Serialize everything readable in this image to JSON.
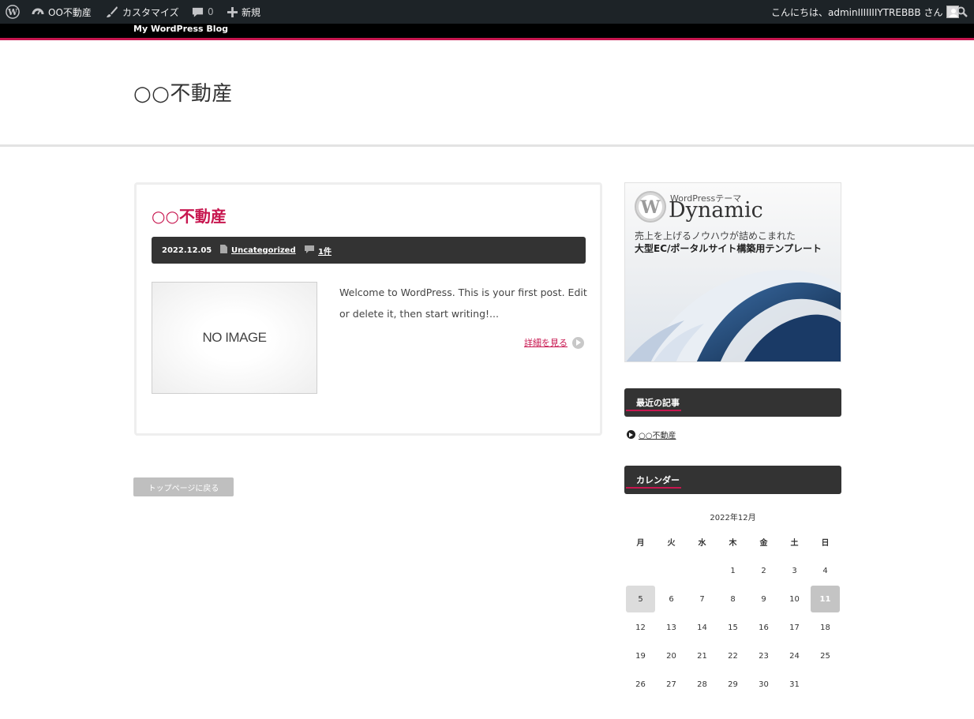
{
  "adminbar": {
    "site_name": "OO不動産",
    "customize": "カスタマイズ",
    "comments_count": "0",
    "new_label": "新規",
    "greeting": "こんにちは、adminIIIIIIIYTREBBB さん"
  },
  "blog_strip": "My WordPress Blog",
  "site_title": "○○不動産",
  "post": {
    "title_prefix": "○○",
    "title_main": "不動産",
    "date": "2022.12.05",
    "category": "Uncategorized",
    "comments": "1件",
    "thumbnail_text": "NO IMAGE",
    "excerpt": "Welcome to WordPress. This is your first post. Edit or delete it, then start writing!...",
    "more_label": "詳細を見る"
  },
  "back_button": "トップページに戻る",
  "banner": {
    "small": "WordPressテーマ",
    "big": "Dynamic",
    "line1": "売上を上げるノウハウが詰めこまれた",
    "line2": "大型EC/ポータルサイト構築用テンプレート"
  },
  "recent": {
    "heading": "最近の記事",
    "items": [
      "○○不動産"
    ]
  },
  "calendar": {
    "heading": "カレンダー",
    "caption": "2022年12月",
    "weekdays": [
      "月",
      "火",
      "水",
      "木",
      "金",
      "土",
      "日"
    ],
    "rows": [
      [
        "",
        "",
        "",
        "1",
        "2",
        "3",
        "4"
      ],
      [
        "5",
        "6",
        "7",
        "8",
        "9",
        "10",
        "11"
      ],
      [
        "12",
        "13",
        "14",
        "15",
        "16",
        "17",
        "18"
      ],
      [
        "19",
        "20",
        "21",
        "22",
        "23",
        "24",
        "25"
      ],
      [
        "26",
        "27",
        "28",
        "29",
        "30",
        "31",
        ""
      ]
    ]
  },
  "colors": {
    "accent": "#c7164f",
    "adminbar": "#1d2327",
    "dark_bar": "#333333"
  }
}
